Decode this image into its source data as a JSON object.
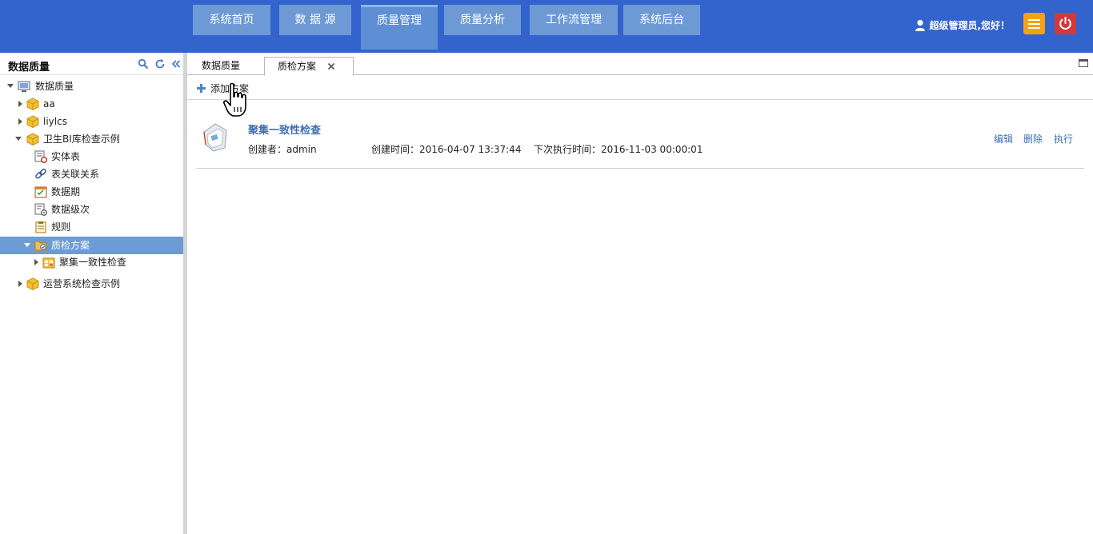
{
  "header": {
    "nav": [
      "系统首页",
      "数 据 源",
      "质量管理",
      "质量分析",
      "工作流管理",
      "系统后台"
    ],
    "active_nav": 2,
    "greeting": "超级管理员,您好！"
  },
  "sidebar": {
    "title": "数据质量",
    "tree": [
      {
        "label": "数据质量",
        "icon": "monitor-icon",
        "expanded": true
      },
      {
        "label": "aa",
        "icon": "cube-icon"
      },
      {
        "label": "liylcs",
        "icon": "cube-icon"
      },
      {
        "label": "卫生BI库检查示例",
        "icon": "cube-icon",
        "expanded": true
      },
      {
        "label": "实体表",
        "icon": "entity-table-icon"
      },
      {
        "label": "表关联关系",
        "icon": "link-icon"
      },
      {
        "label": "数据期",
        "icon": "calendar-icon"
      },
      {
        "label": "数据级次",
        "icon": "level-icon"
      },
      {
        "label": "规则",
        "icon": "clipboard-icon"
      },
      {
        "label": "质检方案",
        "icon": "plan-folder-icon",
        "expanded": true,
        "selected": true
      },
      {
        "label": "聚集一致性检查",
        "icon": "plan-item-icon"
      },
      {
        "label": "运营系统检查示例",
        "icon": "cube-icon"
      }
    ]
  },
  "tabs": [
    "数据质量",
    "质检方案"
  ],
  "toolbar": {
    "add_label": "添加方案"
  },
  "plan": {
    "title": "聚集一致性检查",
    "creator": "创建者：admin",
    "created": "创建时间：2016-04-07 13:37:44",
    "next_run": "下次执行时间：2016-11-03 00:00:01",
    "actions": [
      "编辑",
      "删除",
      "执行"
    ]
  },
  "colors": {
    "header_bg": "#3364cd",
    "nav_btn": "#6d9ad5",
    "selected_row": "#6d9cd3",
    "link": "#3d6fb6",
    "menu_btn": "#f5a212",
    "power_btn": "#d2393c"
  }
}
